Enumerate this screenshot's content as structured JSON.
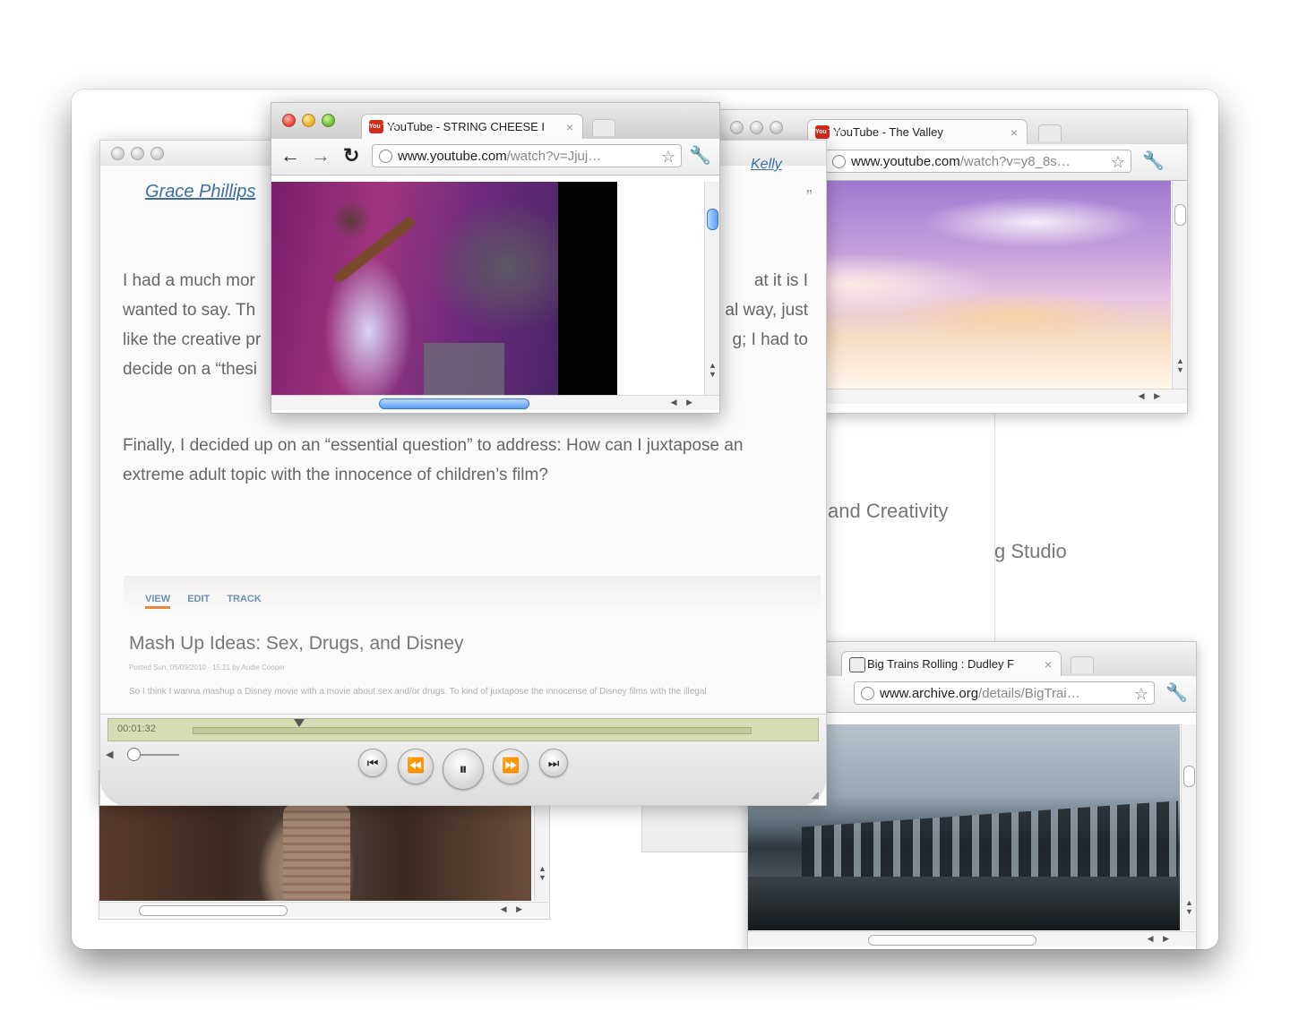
{
  "blog": {
    "author_link": "Grace Phillips",
    "author_link_right": "Kelly",
    "quote_mark": "”",
    "paragraph1_left": [
      "I had a much mor",
      "wanted to say. Th",
      "like the creative pr",
      "decide on a “thesi"
    ],
    "paragraph1_right": [
      "at it is I",
      "al way, just",
      "g; I had to"
    ],
    "paragraph2_line1": "Finally, I decided up on an “essential question” to address: How can I juxtapose an",
    "paragraph2_line2": "extreme adult topic with the innocence of children’s film?",
    "tabs": [
      "VIEW",
      "EDIT",
      "TRACK"
    ],
    "post_title": "Mash Up Ideas: Sex, Drugs, and Disney",
    "post_meta": "Posted Sun, 05/09/2010 - 15:21 by Audie Cooper",
    "post_excerpt": "So I think I wanna mashup a Disney movie with a movie about sex and/or drugs. To kind of juxtapose the innocense of Disney films with the illegal"
  },
  "player": {
    "timecode": "00:01:32",
    "progress": 0.19,
    "buttons": [
      "skip-back",
      "rewind",
      "pause",
      "fast-forward",
      "skip-forward"
    ],
    "icons": {
      "skip_back": "⏮",
      "rewind": "⏪",
      "pause": "⏸",
      "fast_forward": "⏩",
      "skip_forward": "⏭",
      "volume": "◀"
    }
  },
  "browser_front": {
    "tab_title": "YouTube - STRING CHEESE I",
    "url": "www.youtube.com",
    "url_path": "/watch?v=Jjuj…",
    "favicon": "You Tube"
  },
  "browser_right": {
    "tab_title": "YouTube - The Valley",
    "url": "www.youtube.com",
    "url_path": "/watch?v=y8_8s…",
    "favicon": "You Tube"
  },
  "browser_archive": {
    "tab_title": "Big Trains Rolling : Dudley F",
    "url": "www.archive.org",
    "url_path": "/details/BigTrai…"
  },
  "background": {
    "text1": "and Creativity",
    "text2": "g Studio"
  },
  "icons": {
    "back": "←",
    "forward": "→",
    "reload": "↻",
    "star": "☆",
    "wrench": "🔧",
    "close": "×"
  },
  "colors": {
    "link": "#3b6ea8",
    "youtube_red": "#d12b1d"
  }
}
